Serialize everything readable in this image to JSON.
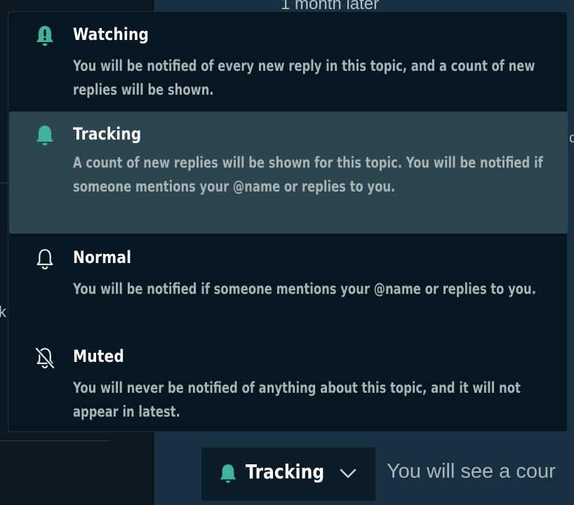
{
  "background": {
    "timeline_label": "1 month later",
    "edge_fragment_left": "k",
    "edge_fragment_right": "o"
  },
  "menu": {
    "items": [
      {
        "id": "watching",
        "title": "Watching",
        "description": "You will be notified of every new reply in this topic, and a count of new replies will be shown.",
        "icon": "bell-exclamation-icon",
        "highlighted": false
      },
      {
        "id": "tracking",
        "title": "Tracking",
        "description": "A count of new replies will be shown for this topic. You will be notified if someone mentions your @name or replies to you.",
        "icon": "bell-filled-icon",
        "highlighted": true
      },
      {
        "id": "normal",
        "title": "Normal",
        "description": "You will be notified if someone mentions your @name or replies to you.",
        "icon": "bell-outline-icon",
        "highlighted": false
      },
      {
        "id": "muted",
        "title": "Muted",
        "description": "You will never be notified of anything about this topic, and it will not appear in latest.",
        "icon": "bell-slash-icon",
        "highlighted": false
      }
    ]
  },
  "notification_button": {
    "label": "Tracking",
    "icon": "bell-filled-icon",
    "dropdown_icon": "chevron-down-icon"
  },
  "notification_reason": "You will see a cour",
  "colors": {
    "accent": "#3fb39d",
    "menu_bg": "#071721",
    "highlight_bg": "#2c464f",
    "title_text": "#ffffff",
    "desc_text": "#a8b4b3"
  }
}
